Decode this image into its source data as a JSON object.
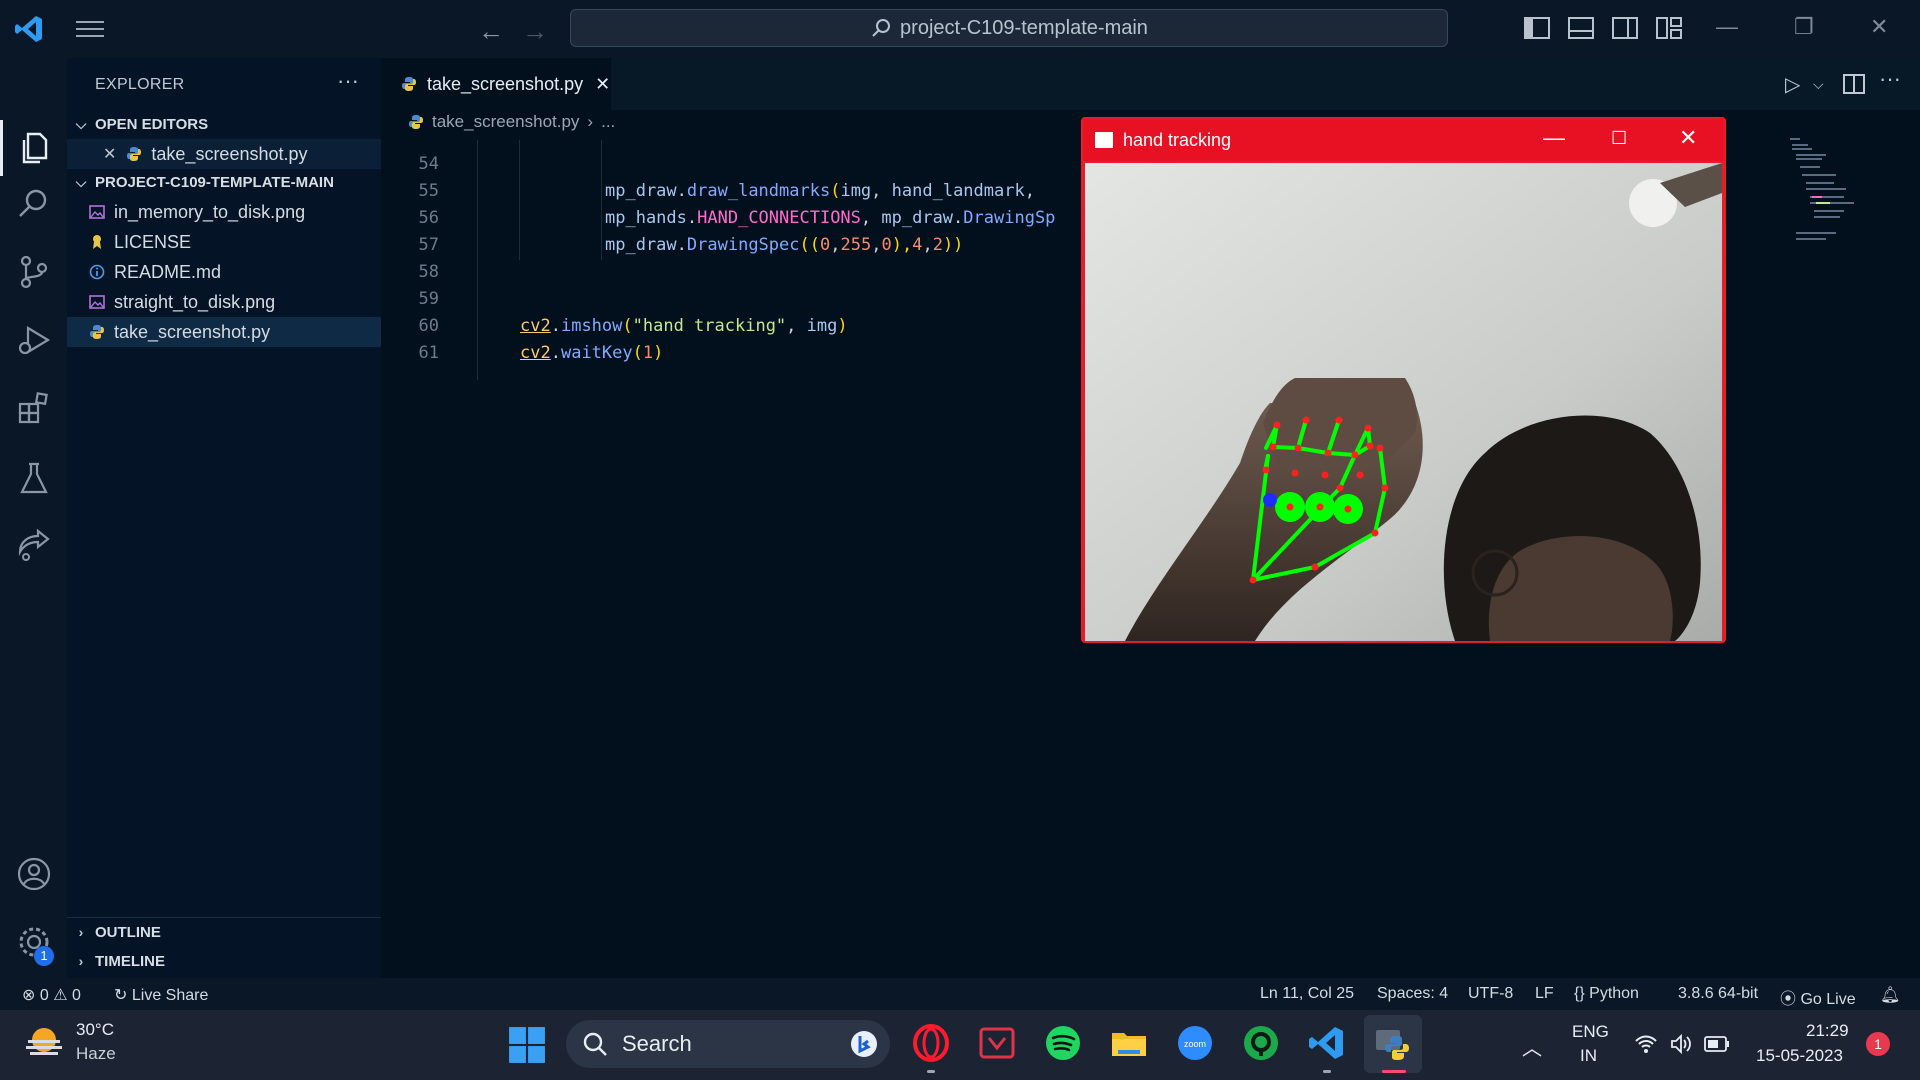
{
  "titlebar": {
    "search_text": "project-C109-template-main"
  },
  "sidebar": {
    "title": "EXPLORER",
    "more": "···",
    "open_editors_label": "OPEN EDITORS",
    "open_editor_file": "take_screenshot.py",
    "project_label": "PROJECT-C109-TEMPLATE-MAIN",
    "files": [
      {
        "name": "in_memory_to_disk.png",
        "icon": "image-file-icon"
      },
      {
        "name": "LICENSE",
        "icon": "license-file-icon"
      },
      {
        "name": "README.md",
        "icon": "info-file-icon"
      },
      {
        "name": "straight_to_disk.png",
        "icon": "image-file-icon"
      },
      {
        "name": "take_screenshot.py",
        "icon": "python-file-icon"
      }
    ],
    "outline_label": "OUTLINE",
    "timeline_label": "TIMELINE",
    "settings_badge": "1"
  },
  "editor": {
    "tab_label": "take_screenshot.py",
    "breadcrumb_file": "take_screenshot.py",
    "breadcrumb_rest": "...",
    "lines": [
      {
        "num": "54"
      },
      {
        "num": "55",
        "seg": [
          "mp_draw",
          ".",
          "draw_landmarks",
          "(",
          "img",
          ", ",
          "hand_landmark",
          ","
        ]
      },
      {
        "num": "56",
        "seg": [
          "mp_hands",
          ".",
          "HAND_CONNECTIONS",
          ", ",
          "mp_draw",
          ".",
          "DrawingSp"
        ]
      },
      {
        "num": "57",
        "seg": [
          "mp_draw",
          ".",
          "DrawingSpec",
          "((",
          "0",
          ",",
          "255",
          ",",
          "0",
          "),",
          "4",
          ",",
          "2",
          "))"
        ]
      },
      {
        "num": "58"
      },
      {
        "num": "59"
      },
      {
        "num": "60",
        "seg": [
          "cv2",
          ".",
          "imshow",
          "(",
          "\"hand tracking\"",
          ", ",
          "img",
          ")"
        ]
      },
      {
        "num": "61",
        "seg": [
          "cv2",
          ".",
          "waitKey",
          "(",
          "1",
          ")"
        ]
      }
    ]
  },
  "cv_window": {
    "title": "hand tracking"
  },
  "statusbar": {
    "errors": "0",
    "warnings": "0",
    "live_share": "Live Share",
    "position": "Ln 11, Col 25",
    "spaces": "Spaces: 4",
    "encoding": "UTF-8",
    "eol": "LF",
    "language": "Python",
    "interpreter": "3.8.6 64-bit",
    "go_live": "Go Live"
  },
  "taskbar": {
    "temperature": "30°C",
    "condition": "Haze",
    "search_label": "Search",
    "lang_top": "ENG",
    "lang_bottom": "IN",
    "time": "21:29",
    "date": "15-05-2023",
    "notification_count": "1"
  },
  "colors": {
    "accent": "#1f6feb",
    "cv_window_red": "#e81123",
    "landmark_green": "#00ff00"
  }
}
